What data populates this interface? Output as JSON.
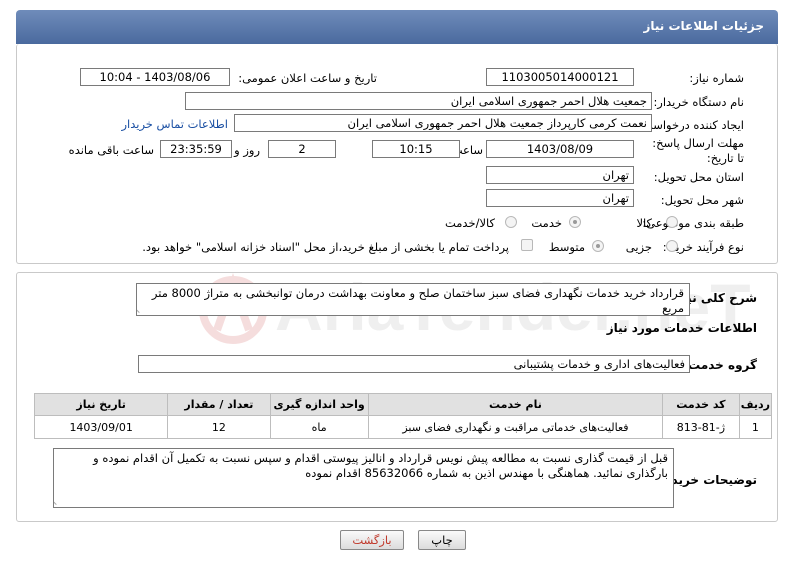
{
  "header": {
    "title": "جزئیات اطلاعات نیاز"
  },
  "fields": {
    "need_number_label": "شماره نیاز:",
    "need_number": "1103005014000121",
    "announce_label": "تاریخ و ساعت اعلان عمومی:",
    "announce_value": "1403/08/06 - 10:04",
    "buyer_org_label": "نام دستگاه خریدار:",
    "buyer_org": "جمعیت هلال احمر جمهوری اسلامی ایران",
    "creator_label": "ایجاد کننده درخواست:",
    "creator": "نعمت کرمی کارپرداز جمعیت هلال احمر جمهوری اسلامی ایران",
    "contact_link": "اطلاعات تماس خریدار",
    "deadline_label": "مهلت ارسال پاسخ: تا تاریخ:",
    "deadline_date": "1403/08/09",
    "time_label": "ساعت",
    "deadline_time": "10:15",
    "days_value": "2",
    "days_label": "روز و",
    "remaining_time": "23:35:59",
    "remaining_label": "ساعت باقی مانده",
    "province_label": "استان محل تحویل:",
    "province": "تهران",
    "city_label": "شهر محل تحویل:",
    "city": "تهران",
    "category_label": "طبقه بندی موضوعی:",
    "category_options": [
      "کالا",
      "خدمت",
      "کالا/خدمت"
    ],
    "process_label": "نوع فرآیند خرید :",
    "process_options": [
      "جزیی",
      "متوسط"
    ],
    "payment_note": "پرداخت تمام یا بخشی از مبلغ خرید،از محل \"اسناد خزانه اسلامی\" خواهد بود."
  },
  "summary": {
    "label": "شرح کلی نیاز:",
    "text": "قرارداد خرید خدمات نگهداری فضای سبز ساختمان صلح و معاونت بهداشت درمان توانبخشی به متراژ 8000 متر مربع"
  },
  "services": {
    "section_title": "اطلاعات خدمات مورد نیاز",
    "group_label": "گروه خدمت:",
    "group_value": "فعالیت‌های اداری و خدمات پشتیبانی",
    "columns": [
      "ردیف",
      "کد خدمت",
      "نام خدمت",
      "واحد اندازه گیری",
      "تعداد / مقدار",
      "تاریخ نیاز"
    ],
    "rows": [
      [
        "1",
        "ژ-81-813",
        "فعالیت‌های خدماتی مراقبت و نگهداری فضای سبز",
        "ماه",
        "12",
        "1403/09/01"
      ]
    ]
  },
  "buyer_notes": {
    "label": "توضیحات خریدار:",
    "text": "قبل از قیمت گذاری نسبت به مطالعه پیش نویس قرارداد و انالیز پیوستی اقدام و سپس نسبت به تکمیل آن اقدام نموده و بارگذاری نمائید. هماهنگی با مهندس اذین به شماره 85632066 اقدام نموده"
  },
  "buttons": {
    "print": "چاپ",
    "back": "بازگشت"
  },
  "watermark": "AriaTender.neT",
  "colors": {
    "header": "#5676a8",
    "back_button_text": "#c0392b",
    "link": "#1a4fa3"
  }
}
